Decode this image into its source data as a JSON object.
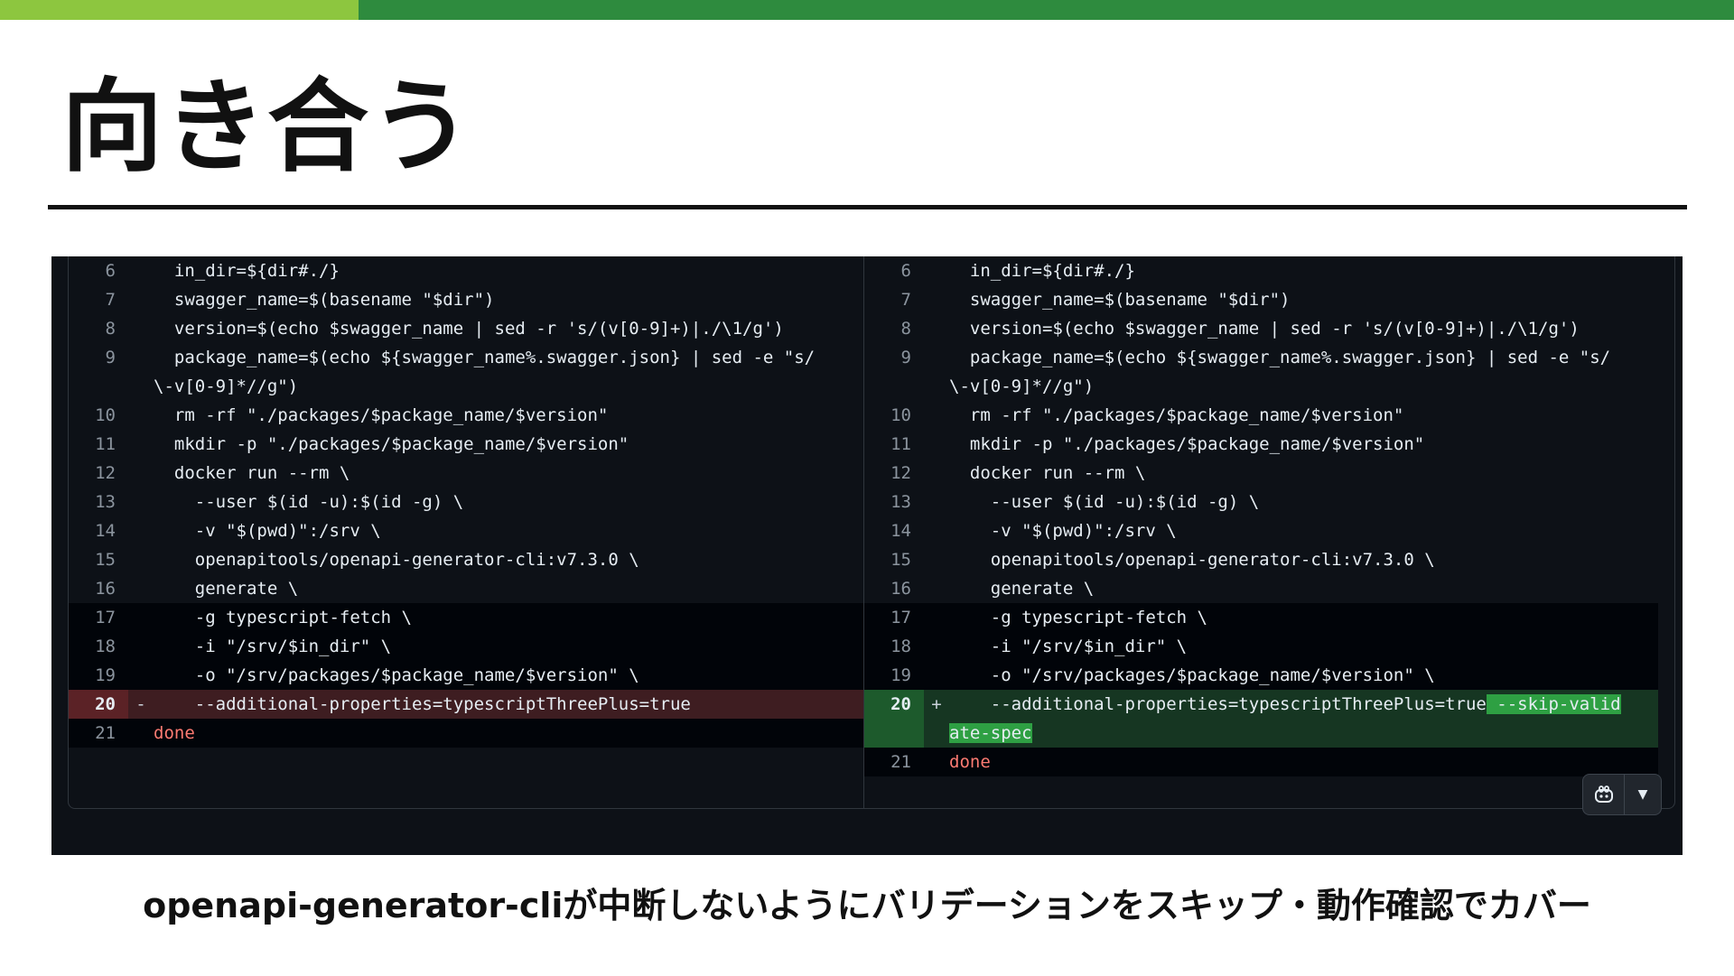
{
  "colors": {
    "topbar_left": "#8dc63f",
    "topbar_right": "#2e8b3e",
    "del_bg": "#3e1d21",
    "add_bg": "#163622",
    "add_highlight": "#2ea043"
  },
  "slide": {
    "title": "向き合う",
    "caption": "openapi-generator-cliが中断しないようにバリデーションをスキップ・動作確認でカバー"
  },
  "diff": {
    "left": [
      {
        "ln": "6",
        "mk": "",
        "code": "  in_dir=${dir#./}",
        "type": "normal"
      },
      {
        "ln": "7",
        "mk": "",
        "code": "  swagger_name=$(basename \"$dir\")",
        "type": "normal"
      },
      {
        "ln": "8",
        "mk": "",
        "code": "  version=$(echo $swagger_name | sed -r 's/(v[0-9]+)|./\\1/g')",
        "type": "normal"
      },
      {
        "ln": "9",
        "mk": "",
        "code": "  package_name=$(echo ${swagger_name%.swagger.json} | sed -e \"s/\\-v[0-9]*//g\")",
        "type": "normal"
      },
      {
        "ln": "10",
        "mk": "",
        "code": "  rm -rf \"./packages/$package_name/$version\"",
        "type": "normal"
      },
      {
        "ln": "11",
        "mk": "",
        "code": "  mkdir -p \"./packages/$package_name/$version\"",
        "type": "normal"
      },
      {
        "ln": "12",
        "mk": "",
        "code": "  docker run --rm \\",
        "type": "normal"
      },
      {
        "ln": "13",
        "mk": "",
        "code": "    --user $(id -u):$(id -g) \\",
        "type": "normal"
      },
      {
        "ln": "14",
        "mk": "",
        "code": "    -v \"$(pwd)\":/srv \\",
        "type": "normal"
      },
      {
        "ln": "15",
        "mk": "",
        "code": "    openapitools/openapi-generator-cli:v7.3.0 \\",
        "type": "normal"
      },
      {
        "ln": "16",
        "mk": "",
        "code": "    generate \\",
        "type": "normal"
      },
      {
        "ln": "17",
        "mk": "",
        "code": "    -g typescript-fetch \\",
        "type": "dim"
      },
      {
        "ln": "18",
        "mk": "",
        "code": "    -i \"/srv/$in_dir\" \\",
        "type": "dim"
      },
      {
        "ln": "19",
        "mk": "",
        "code": "    -o \"/srv/packages/$package_name/$version\" \\",
        "type": "dim"
      },
      {
        "ln": "20",
        "mk": "-",
        "code": "    --additional-properties=typescriptThreePlus=true",
        "type": "del"
      },
      {
        "ln": "21",
        "mk": "",
        "code": "done",
        "type": "dim"
      }
    ],
    "right": [
      {
        "ln": "6",
        "mk": "",
        "code": "  in_dir=${dir#./}",
        "type": "normal"
      },
      {
        "ln": "7",
        "mk": "",
        "code": "  swagger_name=$(basename \"$dir\")",
        "type": "normal"
      },
      {
        "ln": "8",
        "mk": "",
        "code": "  version=$(echo $swagger_name | sed -r 's/(v[0-9]+)|./\\1/g')",
        "type": "normal"
      },
      {
        "ln": "9",
        "mk": "",
        "code": "  package_name=$(echo ${swagger_name%.swagger.json} | sed -e \"s/\\-v[0-9]*//g\")",
        "type": "normal"
      },
      {
        "ln": "10",
        "mk": "",
        "code": "  rm -rf \"./packages/$package_name/$version\"",
        "type": "normal"
      },
      {
        "ln": "11",
        "mk": "",
        "code": "  mkdir -p \"./packages/$package_name/$version\"",
        "type": "normal"
      },
      {
        "ln": "12",
        "mk": "",
        "code": "  docker run --rm \\",
        "type": "normal"
      },
      {
        "ln": "13",
        "mk": "",
        "code": "    --user $(id -u):$(id -g) \\",
        "type": "normal"
      },
      {
        "ln": "14",
        "mk": "",
        "code": "    -v \"$(pwd)\":/srv \\",
        "type": "normal"
      },
      {
        "ln": "15",
        "mk": "",
        "code": "    openapitools/openapi-generator-cli:v7.3.0 \\",
        "type": "normal"
      },
      {
        "ln": "16",
        "mk": "",
        "code": "    generate \\",
        "type": "normal"
      },
      {
        "ln": "17",
        "mk": "",
        "code": "    -g typescript-fetch \\",
        "type": "dim"
      },
      {
        "ln": "18",
        "mk": "",
        "code": "    -i \"/srv/$in_dir\" \\",
        "type": "dim"
      },
      {
        "ln": "19",
        "mk": "",
        "code": "    -o \"/srv/packages/$package_name/$version\" \\",
        "type": "dim"
      },
      {
        "ln": "20",
        "mk": "+",
        "code": "    --additional-properties=typescriptThreePlus=true",
        "added": " --skip-validate-spec",
        "type": "add"
      },
      {
        "ln": "21",
        "mk": "",
        "code": "done",
        "type": "dim"
      }
    ]
  },
  "copilot_button": {
    "icon": "copilot-icon",
    "dropdown_icon": "caret-down-icon"
  }
}
